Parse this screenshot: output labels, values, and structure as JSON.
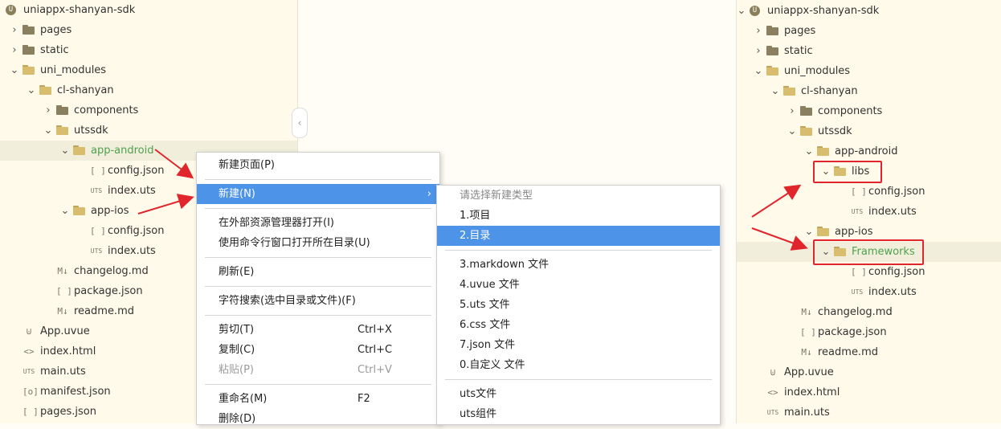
{
  "left_tree": [
    {
      "label": "uniappx-shanyan-sdk",
      "icon": "project-icon",
      "glyph": "U",
      "chevron": "",
      "depth": 0
    },
    {
      "label": "pages",
      "icon": "folder-icon",
      "chevron": "›",
      "depth": 1
    },
    {
      "label": "static",
      "icon": "folder-icon",
      "chevron": "›",
      "depth": 1
    },
    {
      "label": "uni_modules",
      "icon": "folder-open-icon",
      "chevron": "⌄",
      "depth": 1
    },
    {
      "label": "cl-shanyan",
      "icon": "folder-open-icon",
      "chevron": "⌄",
      "depth": 2
    },
    {
      "label": "components",
      "icon": "folder-icon",
      "chevron": "›",
      "depth": 3
    },
    {
      "label": "utssdk",
      "icon": "folder-open-icon",
      "chevron": "⌄",
      "depth": 3
    },
    {
      "label": "app-android",
      "icon": "folder-open-icon",
      "chevron": "⌄",
      "depth": 4,
      "green": true,
      "selected": true
    },
    {
      "label": "config.json",
      "icon": "json-file-icon",
      "glyph": "[ ]",
      "chevron": "",
      "depth": 5
    },
    {
      "label": "index.uts",
      "icon": "uts-file-icon",
      "glyph": "UTS",
      "chevron": "",
      "depth": 5
    },
    {
      "label": "app-ios",
      "icon": "folder-open-icon",
      "chevron": "⌄",
      "depth": 4
    },
    {
      "label": "config.json",
      "icon": "json-file-icon",
      "glyph": "[ ]",
      "chevron": "",
      "depth": 5
    },
    {
      "label": "index.uts",
      "icon": "uts-file-icon",
      "glyph": "UTS",
      "chevron": "",
      "depth": 5
    },
    {
      "label": "changelog.md",
      "icon": "markdown-file-icon",
      "glyph": "M↓",
      "chevron": "",
      "depth": 3
    },
    {
      "label": "package.json",
      "icon": "json-file-icon",
      "glyph": "[ ]",
      "chevron": "",
      "depth": 3
    },
    {
      "label": "readme.md",
      "icon": "markdown-file-icon",
      "glyph": "M↓",
      "chevron": "",
      "depth": 3
    },
    {
      "label": "App.uvue",
      "icon": "vue-file-icon",
      "glyph": "⊍",
      "chevron": "",
      "depth": 1
    },
    {
      "label": "index.html",
      "icon": "html-file-icon",
      "glyph": "<>",
      "chevron": "",
      "depth": 1
    },
    {
      "label": "main.uts",
      "icon": "uts-file-icon",
      "glyph": "UTS",
      "chevron": "",
      "depth": 1
    },
    {
      "label": "manifest.json",
      "icon": "manifest-file-icon",
      "glyph": "[o]",
      "chevron": "",
      "depth": 1
    },
    {
      "label": "pages.json",
      "icon": "json-file-icon",
      "glyph": "[ ]",
      "chevron": "",
      "depth": 1
    }
  ],
  "right_tree": [
    {
      "label": "uniappx-shanyan-sdk",
      "icon": "project-icon",
      "glyph": "U",
      "chevron": "⌄",
      "depth": 0
    },
    {
      "label": "pages",
      "icon": "folder-icon",
      "chevron": "›",
      "depth": 1
    },
    {
      "label": "static",
      "icon": "folder-icon",
      "chevron": "›",
      "depth": 1
    },
    {
      "label": "uni_modules",
      "icon": "folder-open-icon",
      "chevron": "⌄",
      "depth": 1
    },
    {
      "label": "cl-shanyan",
      "icon": "folder-open-icon",
      "chevron": "⌄",
      "depth": 2
    },
    {
      "label": "components",
      "icon": "folder-icon",
      "chevron": "›",
      "depth": 3
    },
    {
      "label": "utssdk",
      "icon": "folder-open-icon",
      "chevron": "⌄",
      "depth": 3
    },
    {
      "label": "app-android",
      "icon": "folder-open-icon",
      "chevron": "⌄",
      "depth": 4
    },
    {
      "label": "libs",
      "icon": "folder-open-icon",
      "chevron": "⌄",
      "depth": 5
    },
    {
      "label": "config.json",
      "icon": "json-file-icon",
      "glyph": "[ ]",
      "chevron": "",
      "depth": 6
    },
    {
      "label": "index.uts",
      "icon": "uts-file-icon",
      "glyph": "UTS",
      "chevron": "",
      "depth": 6
    },
    {
      "label": "app-ios",
      "icon": "folder-open-icon",
      "chevron": "⌄",
      "depth": 4
    },
    {
      "label": "Frameworks",
      "icon": "folder-open-icon",
      "chevron": "⌄",
      "depth": 5,
      "green": true,
      "selected": true
    },
    {
      "label": "config.json",
      "icon": "json-file-icon",
      "glyph": "[ ]",
      "chevron": "",
      "depth": 6
    },
    {
      "label": "index.uts",
      "icon": "uts-file-icon",
      "glyph": "UTS",
      "chevron": "",
      "depth": 6
    },
    {
      "label": "changelog.md",
      "icon": "markdown-file-icon",
      "glyph": "M↓",
      "chevron": "",
      "depth": 3
    },
    {
      "label": "package.json",
      "icon": "json-file-icon",
      "glyph": "[ ]",
      "chevron": "",
      "depth": 3
    },
    {
      "label": "readme.md",
      "icon": "markdown-file-icon",
      "glyph": "M↓",
      "chevron": "",
      "depth": 3
    },
    {
      "label": "App.uvue",
      "icon": "vue-file-icon",
      "glyph": "⊍",
      "chevron": "",
      "depth": 1
    },
    {
      "label": "index.html",
      "icon": "html-file-icon",
      "glyph": "<>",
      "chevron": "",
      "depth": 1
    },
    {
      "label": "main.uts",
      "icon": "uts-file-icon",
      "glyph": "UTS",
      "chevron": "",
      "depth": 1
    }
  ],
  "context_menu": {
    "new_page": "新建页面(P)",
    "new": "新建(N)",
    "new_arrow": "›",
    "open_in_explorer": "在外部资源管理器打开(I)",
    "open_in_terminal": "使用命令行窗口打开所在目录(U)",
    "refresh": "刷新(E)",
    "search_text": "字符搜索(选中目录或文件)(F)",
    "cut": "剪切(T)",
    "cut_shortcut": "Ctrl+X",
    "copy": "复制(C)",
    "copy_shortcut": "Ctrl+C",
    "paste": "粘贴(P)",
    "paste_shortcut": "Ctrl+V",
    "rename": "重命名(M)",
    "rename_shortcut": "F2",
    "delete": "删除(D)"
  },
  "sub_menu": {
    "header": "请选择新建类型",
    "project": "1.项目",
    "directory": "2.目录",
    "markdown": "3.markdown 文件",
    "uvue": "4.uvue 文件",
    "uts": "5.uts 文件",
    "css": "6.css 文件",
    "json": "7.json 文件",
    "custom": "0.自定义 文件",
    "uts_file": "uts文件",
    "uts_component": "uts组件"
  },
  "colors": {
    "annotation_red": "#e0262c",
    "selection_blue": "#4d94e8",
    "folder_green_text": "#4ea24e"
  }
}
